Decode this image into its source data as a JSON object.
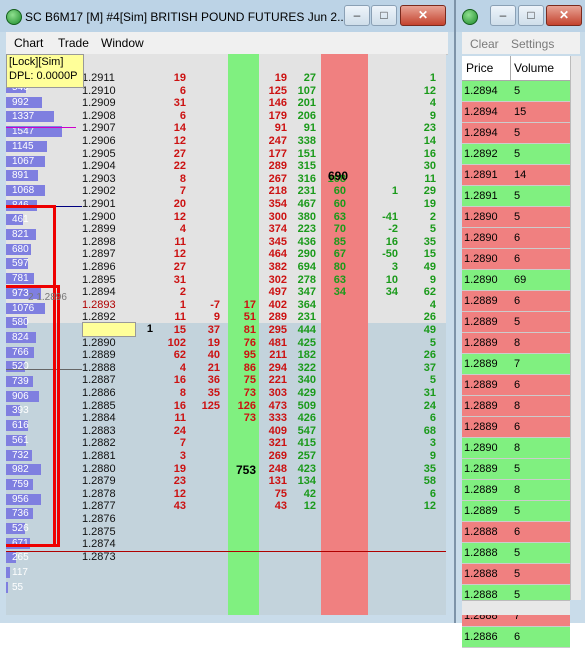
{
  "left_window": {
    "title": "SC B6M17 [M] #4[Sim]  BRITISH POUND FUTURES Jun 2...",
    "minimize": "–",
    "maximize": "□",
    "close": "✕",
    "menu": [
      "Chart",
      "Trade",
      "Window"
    ],
    "lock_label": "[Lock][Sim]",
    "dpl_label": "DPL: 0.0000P",
    "side_label": "2 1.2896",
    "current_price": "1.2893",
    "mid_values": {
      "position": "1",
      "big_bid": "753",
      "big_ask": "690"
    }
  },
  "volume_profile": [
    {
      "v": "540",
      "f": 0.35
    },
    {
      "v": "992",
      "f": 0.64
    },
    {
      "v": "1337",
      "f": 0.86
    },
    {
      "v": "1547",
      "f": 1.0
    },
    {
      "v": "1145",
      "f": 0.74
    },
    {
      "v": "1067",
      "f": 0.69
    },
    {
      "v": "891",
      "f": 0.58
    },
    {
      "v": "1068",
      "f": 0.69
    },
    {
      "v": "846",
      "f": 0.55
    },
    {
      "v": "461",
      "f": 0.3
    },
    {
      "v": "821",
      "f": 0.53
    },
    {
      "v": "680",
      "f": 0.44
    },
    {
      "v": "597",
      "f": 0.39
    },
    {
      "v": "781",
      "f": 0.5
    },
    {
      "v": "973",
      "f": 0.63
    },
    {
      "v": "1076",
      "f": 0.7
    },
    {
      "v": "580",
      "f": 0.37
    },
    {
      "v": "824",
      "f": 0.53
    },
    {
      "v": "766",
      "f": 0.5
    },
    {
      "v": "520",
      "f": 0.34
    },
    {
      "v": "739",
      "f": 0.48
    },
    {
      "v": "906",
      "f": 0.59
    },
    {
      "v": "393",
      "f": 0.25
    },
    {
      "v": "616",
      "f": 0.4
    },
    {
      "v": "561",
      "f": 0.36
    },
    {
      "v": "732",
      "f": 0.47
    },
    {
      "v": "982",
      "f": 0.63
    },
    {
      "v": "759",
      "f": 0.49
    },
    {
      "v": "956",
      "f": 0.62
    },
    {
      "v": "736",
      "f": 0.48
    },
    {
      "v": "526",
      "f": 0.34
    },
    {
      "v": "671",
      "f": 0.43
    },
    {
      "v": "265",
      "f": 0.17
    },
    {
      "v": "117",
      "f": 0.08
    },
    {
      "v": "55",
      "f": 0.04
    }
  ],
  "ladder": [
    {
      "p": "1.2911",
      "a": "19",
      "b": "",
      "c": "19",
      "d": "27",
      "e": "",
      "g": "1"
    },
    {
      "p": "1.2910",
      "a": "6",
      "b": "",
      "c": "125",
      "d": "107",
      "e": "",
      "g": "12"
    },
    {
      "p": "1.2909",
      "a": "31",
      "b": "",
      "c": "146",
      "d": "201",
      "e": "",
      "g": "4"
    },
    {
      "p": "1.2908",
      "a": "6",
      "b": "",
      "c": "179",
      "d": "206",
      "e": "",
      "g": "9"
    },
    {
      "p": "1.2907",
      "a": "14",
      "b": "",
      "c": "91",
      "d": "91",
      "e": "",
      "g": "23"
    },
    {
      "p": "1.2906",
      "a": "12",
      "b": "",
      "c": "247",
      "d": "338",
      "e": "",
      "g": "14"
    },
    {
      "p": "1.2905",
      "a": "27",
      "b": "",
      "c": "177",
      "d": "151",
      "e": "",
      "g": "16"
    },
    {
      "p": "1.2904",
      "a": "22",
      "b": "",
      "c": "289",
      "d": "315",
      "e": "",
      "g": "30"
    },
    {
      "p": "1.2903",
      "a": "8",
      "b": "",
      "c": "267",
      "d": "316",
      "e": "108",
      "g": "11"
    },
    {
      "p": "1.2902",
      "a": "7",
      "b": "",
      "c": "218",
      "d": "231",
      "e": "60",
      "f": "1",
      "g": "29"
    },
    {
      "p": "1.2901",
      "a": "20",
      "b": "",
      "c": "354",
      "d": "467",
      "e": "60",
      "f": "",
      "g": "19"
    },
    {
      "p": "1.2900",
      "a": "12",
      "b": "",
      "c": "300",
      "d": "380",
      "e": "63",
      "f": "-41",
      "g": "2"
    },
    {
      "p": "1.2899",
      "a": "4",
      "b": "",
      "c": "374",
      "d": "223",
      "e": "70",
      "f": "-2",
      "g": "5"
    },
    {
      "p": "1.2898",
      "a": "11",
      "b": "",
      "c": "345",
      "d": "436",
      "e": "85",
      "f": "16",
      "g": "35"
    },
    {
      "p": "1.2897",
      "a": "12",
      "b": "",
      "c": "464",
      "d": "290",
      "e": "67",
      "f": "-50",
      "g": "15"
    },
    {
      "p": "1.2896",
      "a": "27",
      "b": "",
      "c": "382",
      "d": "694",
      "e": "80",
      "f": "3",
      "g": "49"
    },
    {
      "p": "1.2895",
      "a": "31",
      "b": "",
      "c": "302",
      "d": "278",
      "e": "63",
      "f": "10",
      "g": "9"
    },
    {
      "p": "1.2894",
      "a": "2",
      "b": "",
      "c": "497",
      "d": "347",
      "e": "34",
      "f": "34",
      "g": "62"
    },
    {
      "p": "1.2893",
      "a": "1",
      "b": "-7",
      "k": "17",
      "c": "402",
      "d": "364",
      "g": "4"
    },
    {
      "p": "1.2892",
      "a": "11",
      "b": "9",
      "k": "51",
      "c": "289",
      "d": "231",
      "g": "26"
    },
    {
      "p": "1.2891",
      "a": "15",
      "b": "37",
      "k": "81",
      "c": "295",
      "d": "444",
      "g": "49"
    },
    {
      "p": "1.2890",
      "a": "102",
      "b": "19",
      "k": "76",
      "c": "481",
      "d": "425",
      "g": "5"
    },
    {
      "p": "1.2889",
      "a": "62",
      "b": "40",
      "k": "95",
      "c": "211",
      "d": "182",
      "g": "26"
    },
    {
      "p": "1.2888",
      "a": "4",
      "b": "21",
      "k": "86",
      "c": "294",
      "d": "322",
      "g": "37"
    },
    {
      "p": "1.2887",
      "a": "16",
      "b": "36",
      "k": "75",
      "c": "221",
      "d": "340",
      "g": "5"
    },
    {
      "p": "1.2886",
      "a": "8",
      "b": "35",
      "k": "73",
      "c": "303",
      "d": "429",
      "g": "31"
    },
    {
      "p": "1.2885",
      "a": "16",
      "b": "125",
      "k": "126",
      "c": "473",
      "d": "509",
      "g": "24"
    },
    {
      "p": "1.2884",
      "a": "11",
      "b": "",
      "k": "73",
      "c": "333",
      "d": "426",
      "g": "6"
    },
    {
      "p": "1.2883",
      "a": "24",
      "b": "",
      "k": "",
      "c": "409",
      "d": "547",
      "g": "68"
    },
    {
      "p": "1.2882",
      "a": "7",
      "b": "",
      "k": "",
      "c": "321",
      "d": "415",
      "g": "3"
    },
    {
      "p": "1.2881",
      "a": "3",
      "b": "",
      "k": "",
      "c": "269",
      "d": "257",
      "g": "9"
    },
    {
      "p": "1.2880",
      "a": "19",
      "b": "",
      "k": "",
      "c": "248",
      "d": "423",
      "g": "35"
    },
    {
      "p": "1.2879",
      "a": "23",
      "b": "",
      "k": "",
      "c": "131",
      "d": "134",
      "g": "58"
    },
    {
      "p": "1.2878",
      "a": "12",
      "b": "",
      "k": "",
      "c": "75",
      "d": "42",
      "g": "6"
    },
    {
      "p": "1.2877",
      "a": "43",
      "b": "",
      "k": "",
      "c": "43",
      "d": "12",
      "g": "12"
    },
    {
      "p": "1.2876",
      "a": "",
      "b": "",
      "k": "",
      "c": "",
      "d": "",
      "g": ""
    },
    {
      "p": "1.2875",
      "a": "",
      "b": "",
      "k": "",
      "c": "",
      "d": "",
      "g": ""
    },
    {
      "p": "1.2874",
      "a": "",
      "b": "",
      "k": "",
      "c": "",
      "d": "",
      "g": ""
    },
    {
      "p": "1.2873",
      "a": "",
      "b": "",
      "k": "",
      "c": "",
      "d": "",
      "g": ""
    }
  ],
  "right_window": {
    "toolbar": {
      "clear": "Clear",
      "settings": "Settings"
    },
    "headers": {
      "price": "Price",
      "volume": "Volume"
    },
    "rows": [
      {
        "p": "1.2894",
        "v": "5",
        "side": "buy"
      },
      {
        "p": "1.2894",
        "v": "15",
        "side": "sell"
      },
      {
        "p": "1.2894",
        "v": "5",
        "side": "sell"
      },
      {
        "p": "1.2892",
        "v": "5",
        "side": "buy"
      },
      {
        "p": "1.2891",
        "v": "14",
        "side": "sell"
      },
      {
        "p": "1.2891",
        "v": "5",
        "side": "buy"
      },
      {
        "p": "1.2890",
        "v": "5",
        "side": "sell"
      },
      {
        "p": "1.2890",
        "v": "6",
        "side": "sell"
      },
      {
        "p": "1.2890",
        "v": "6",
        "side": "sell"
      },
      {
        "p": "1.2890",
        "v": "69",
        "side": "buy"
      },
      {
        "p": "1.2889",
        "v": "6",
        "side": "sell"
      },
      {
        "p": "1.2889",
        "v": "5",
        "side": "sell"
      },
      {
        "p": "1.2889",
        "v": "8",
        "side": "sell"
      },
      {
        "p": "1.2889",
        "v": "7",
        "side": "buy"
      },
      {
        "p": "1.2889",
        "v": "6",
        "side": "sell"
      },
      {
        "p": "1.2889",
        "v": "8",
        "side": "sell"
      },
      {
        "p": "1.2889",
        "v": "6",
        "side": "sell"
      },
      {
        "p": "1.2890",
        "v": "8",
        "side": "buy"
      },
      {
        "p": "1.2889",
        "v": "5",
        "side": "buy"
      },
      {
        "p": "1.2889",
        "v": "8",
        "side": "buy"
      },
      {
        "p": "1.2889",
        "v": "5",
        "side": "buy"
      },
      {
        "p": "1.2888",
        "v": "6",
        "side": "sell"
      },
      {
        "p": "1.2888",
        "v": "5",
        "side": "buy"
      },
      {
        "p": "1.2888",
        "v": "5",
        "side": "sell"
      },
      {
        "p": "1.2888",
        "v": "5",
        "side": "buy"
      },
      {
        "p": "1.2888",
        "v": "7",
        "side": "sell"
      },
      {
        "p": "1.2886",
        "v": "6",
        "side": "buy"
      }
    ]
  },
  "colors": {
    "buy": "#80f080",
    "sell": "#f08080",
    "bid_text": "#cc1111",
    "ask_text": "#1a9a1a",
    "highlight": "#ffff99"
  }
}
